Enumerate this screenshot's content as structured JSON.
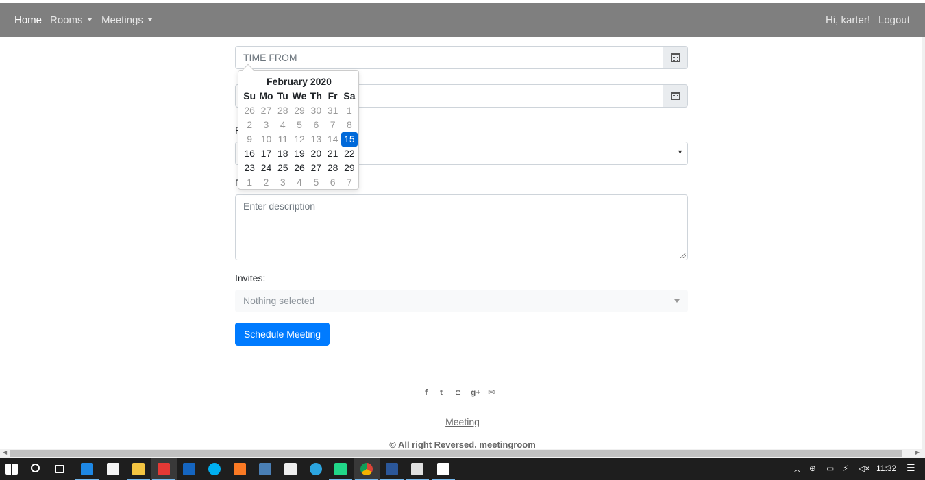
{
  "navbar": {
    "home": "Home",
    "rooms": "Rooms",
    "meetings": "Meetings",
    "greeting": "Hi, karter!",
    "logout": "Logout"
  },
  "form": {
    "time_from_placeholder": "TIME FROM",
    "description_placeholder": "Enter description",
    "invites_label": "Invites:",
    "invites_placeholder": "Nothing selected",
    "submit_label": "Schedule Meeting",
    "partial_label_r": "R",
    "partial_label_d": "D"
  },
  "datepicker": {
    "title": "February 2020",
    "days_of_week": [
      "Su",
      "Mo",
      "Tu",
      "We",
      "Th",
      "Fr",
      "Sa"
    ],
    "weeks": [
      [
        "26",
        "27",
        "28",
        "29",
        "30",
        "31",
        "1"
      ],
      [
        "2",
        "3",
        "4",
        "5",
        "6",
        "7",
        "8"
      ],
      [
        "9",
        "10",
        "11",
        "12",
        "13",
        "14",
        "15"
      ],
      [
        "16",
        "17",
        "18",
        "19",
        "20",
        "21",
        "22"
      ],
      [
        "23",
        "24",
        "25",
        "26",
        "27",
        "28",
        "29"
      ],
      [
        "1",
        "2",
        "3",
        "4",
        "5",
        "6",
        "7"
      ]
    ],
    "selected": "15",
    "muted_rows": [
      0,
      1,
      2,
      5
    ],
    "muted_except": [
      "15"
    ]
  },
  "footer": {
    "social_icons": [
      "facebook-icon",
      "twitter-icon",
      "instagram-icon",
      "google-plus-icon",
      "envelope-icon"
    ],
    "social_glyphs": [
      "f",
      "t",
      "◘",
      "g+",
      "✉"
    ],
    "link": "Meeting",
    "copyright": "© All right Reversed. meetingroom"
  },
  "taskbar": {
    "time": "11:32",
    "icons": [
      "windows-start-icon",
      "search-icon",
      "task-view-icon",
      "edge-icon",
      "store-icon",
      "file-explorer-icon",
      "opera-icon",
      "powershell-icon",
      "skype-icon",
      "xampp-icon",
      "notepad-icon",
      "mail-icon",
      "telegram-icon",
      "pycharm-icon",
      "chrome-icon",
      "word-icon",
      "photos-icon",
      "settings-icon"
    ]
  },
  "colors": {
    "navbar_bg": "#7f7f7f",
    "primary": "#007bff",
    "selected_day": "#0069d9",
    "taskbar_bg": "#1e1e1e"
  }
}
